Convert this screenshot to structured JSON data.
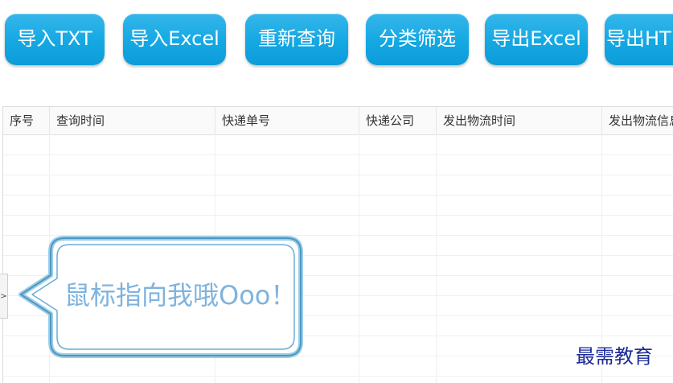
{
  "toolbar": {
    "buttons": [
      {
        "label": "导入TXT"
      },
      {
        "label": "导入Excel"
      },
      {
        "label": "重新查询"
      },
      {
        "label": "分类筛选"
      },
      {
        "label": "导出Excel"
      },
      {
        "label": "导出HTML"
      }
    ]
  },
  "table": {
    "columns": [
      {
        "label": "序号"
      },
      {
        "label": "查询时间"
      },
      {
        "label": "快递单号"
      },
      {
        "label": "快递公司"
      },
      {
        "label": "发出物流时间"
      },
      {
        "label": "发出物流信息"
      }
    ]
  },
  "sidebar_toggle": {
    "label": ">"
  },
  "callout": {
    "text": "鼠标指向我哦Ooo！"
  },
  "watermark": {
    "text": "最需教育"
  },
  "colors": {
    "button_gradient_top": "#35b6ea",
    "button_gradient_bottom": "#0d9cd9",
    "callout_text": "#7fb3de",
    "callout_border": "#5aa8d0",
    "watermark": "#1b2a9a"
  }
}
